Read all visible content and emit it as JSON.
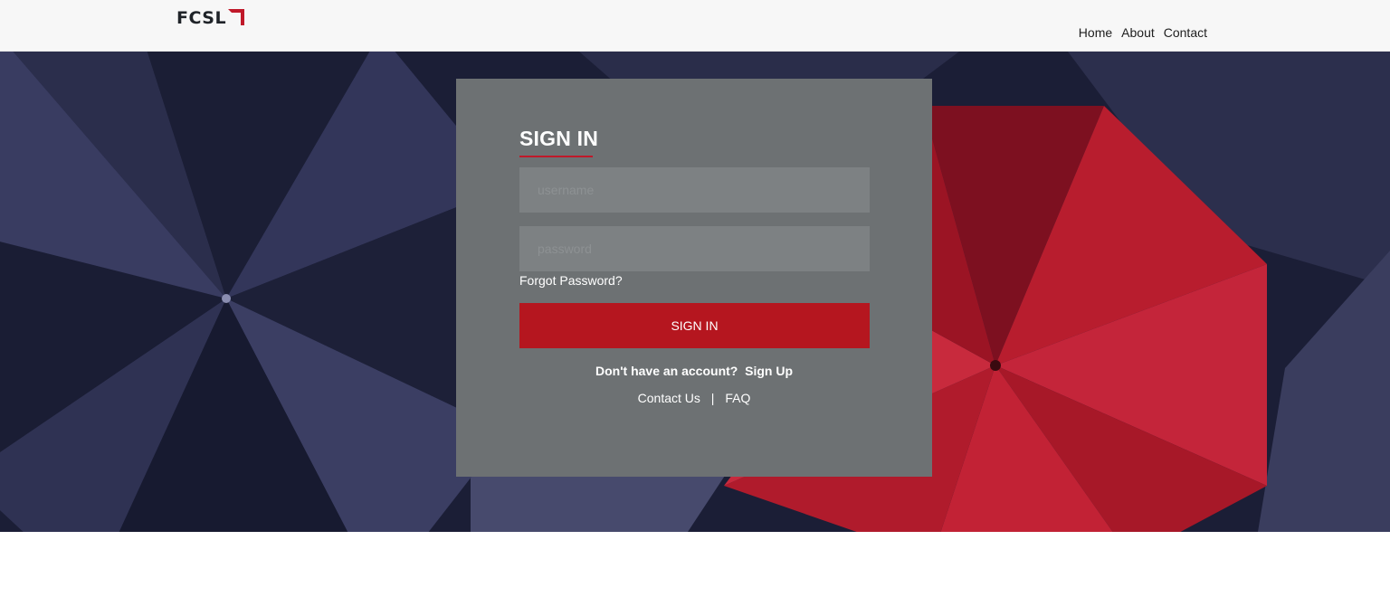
{
  "header": {
    "logo_text": "FCSL",
    "nav": [
      {
        "label": "Home"
      },
      {
        "label": "About"
      },
      {
        "label": "Contact"
      }
    ]
  },
  "login": {
    "title": "SIGN IN",
    "username_placeholder": "username",
    "password_placeholder": "password",
    "forgot_label": "Forgot Password?",
    "submit_label": "SIGN IN",
    "no_account_text": "Don't have an account?",
    "signup_label": "Sign Up",
    "contact_label": "Contact Us",
    "separator": "|",
    "faq_label": "FAQ"
  },
  "colors": {
    "accent": "#b5161f",
    "card_bg": "#6d7173",
    "field_bg": "#7d8183",
    "header_bg": "#f7f7f7"
  }
}
